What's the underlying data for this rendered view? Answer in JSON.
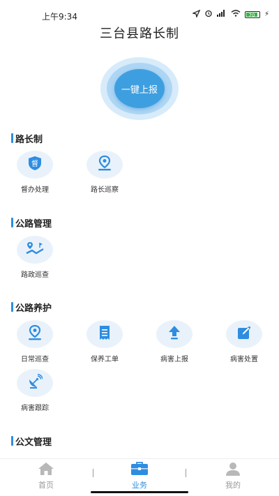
{
  "status_bar": {
    "time": "上午9:34",
    "battery": "70"
  },
  "header": {
    "title": "三台县路长制"
  },
  "report_button": {
    "label": "一键上报"
  },
  "sections": {
    "road_chief": {
      "title": "路长制",
      "items": [
        {
          "label": "督办处理",
          "icon": "supervise-badge-icon",
          "badge_text": "督"
        },
        {
          "label": "路长巡察",
          "icon": "location-pin-icon"
        }
      ]
    },
    "highway_mgmt": {
      "title": "公路管理",
      "items": [
        {
          "label": "路政巡查",
          "icon": "route-map-icon"
        }
      ]
    },
    "highway_maint": {
      "title": "公路养护",
      "items": [
        {
          "label": "日常巡查",
          "icon": "location-pin-icon"
        },
        {
          "label": "保养工单",
          "icon": "work-order-icon"
        },
        {
          "label": "病害上报",
          "icon": "upload-arrow-icon"
        },
        {
          "label": "病害处置",
          "icon": "edit-pen-icon"
        },
        {
          "label": "病害跟踪",
          "icon": "satellite-dish-icon"
        }
      ]
    },
    "document_mgmt": {
      "title": "公文管理"
    }
  },
  "bottom_nav": {
    "items": [
      {
        "label": "首页",
        "icon": "home-icon",
        "active": false
      },
      {
        "label": "业务",
        "icon": "briefcase-icon",
        "active": true
      },
      {
        "label": "我的",
        "icon": "user-icon",
        "active": false
      }
    ]
  },
  "colors": {
    "accent": "#2e8de0",
    "active_nav": "#2e8de0",
    "inactive_nav": "#b8b8b8",
    "tile_bg": "#e9f2fa"
  }
}
